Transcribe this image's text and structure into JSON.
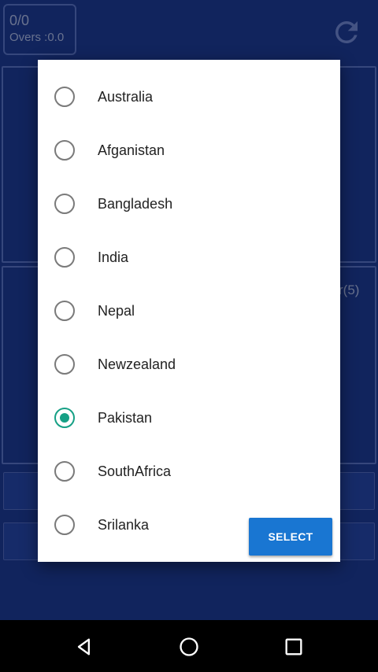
{
  "background": {
    "score": "0/0",
    "overs": "Overs :0.0",
    "partial_label": "r(5)"
  },
  "dialog": {
    "options": [
      {
        "label": "Australia",
        "checked": false
      },
      {
        "label": "Afganistan",
        "checked": false
      },
      {
        "label": "Bangladesh",
        "checked": false
      },
      {
        "label": "India",
        "checked": false
      },
      {
        "label": "Nepal",
        "checked": false
      },
      {
        "label": "Newzealand",
        "checked": false
      },
      {
        "label": "Pakistan",
        "checked": true
      },
      {
        "label": "SouthAfrica",
        "checked": false
      },
      {
        "label": "Srilanka",
        "checked": false
      }
    ],
    "select_label": "SELECT"
  },
  "colors": {
    "app_background": "#1c3a97",
    "accent_radio": "#16a085",
    "select_button": "#1976d2"
  },
  "icons": {
    "refresh": "refresh-icon",
    "back": "nav-back-icon",
    "home": "nav-home-icon",
    "recents": "nav-recents-icon"
  }
}
